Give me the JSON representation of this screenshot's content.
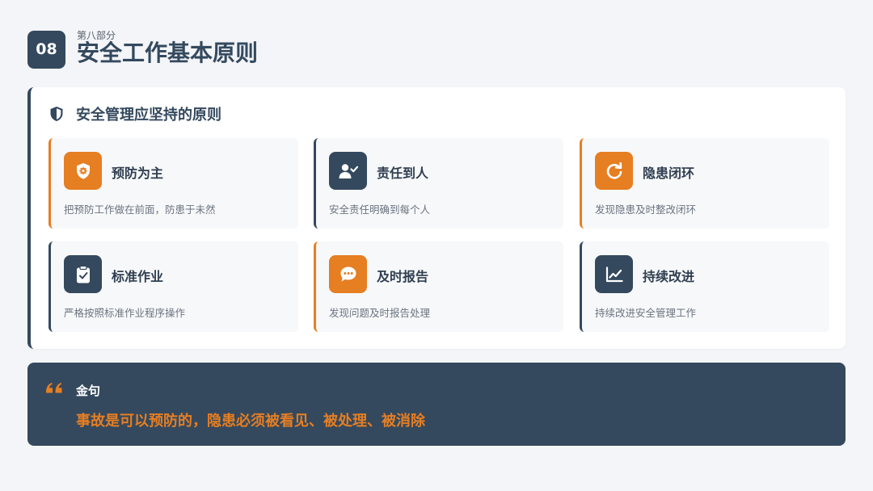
{
  "header": {
    "number": "08",
    "section_label": "第八部分",
    "title": "安全工作基本原则"
  },
  "colors": {
    "accent": "#e67e22",
    "primary": "#34495e",
    "background": "#f3f5f8"
  },
  "principles": {
    "heading": "安全管理应坚持的原则",
    "heading_icon": "shield-icon",
    "items": [
      {
        "title": "预防为主",
        "desc": "把预防工作做在前面，防患于未然",
        "icon": "shield-gear-icon",
        "style": "accent"
      },
      {
        "title": "责任到人",
        "desc": "安全责任明确到每个人",
        "icon": "user-check-icon",
        "style": "dark"
      },
      {
        "title": "隐患闭环",
        "desc": "发现隐患及时整改闭环",
        "icon": "refresh-icon",
        "style": "accent"
      },
      {
        "title": "标准作业",
        "desc": "严格按照标准作业程序操作",
        "icon": "clipboard-check-icon",
        "style": "dark"
      },
      {
        "title": "及时报告",
        "desc": "发现问题及时报告处理",
        "icon": "chat-bubble-icon",
        "style": "accent"
      },
      {
        "title": "持续改进",
        "desc": "持续改进安全管理工作",
        "icon": "line-chart-icon",
        "style": "dark"
      }
    ]
  },
  "quote": {
    "label": "金句",
    "text": "事故是可以预防的，隐患必须被看见、被处理、被消除",
    "icon": "quote-icon"
  }
}
